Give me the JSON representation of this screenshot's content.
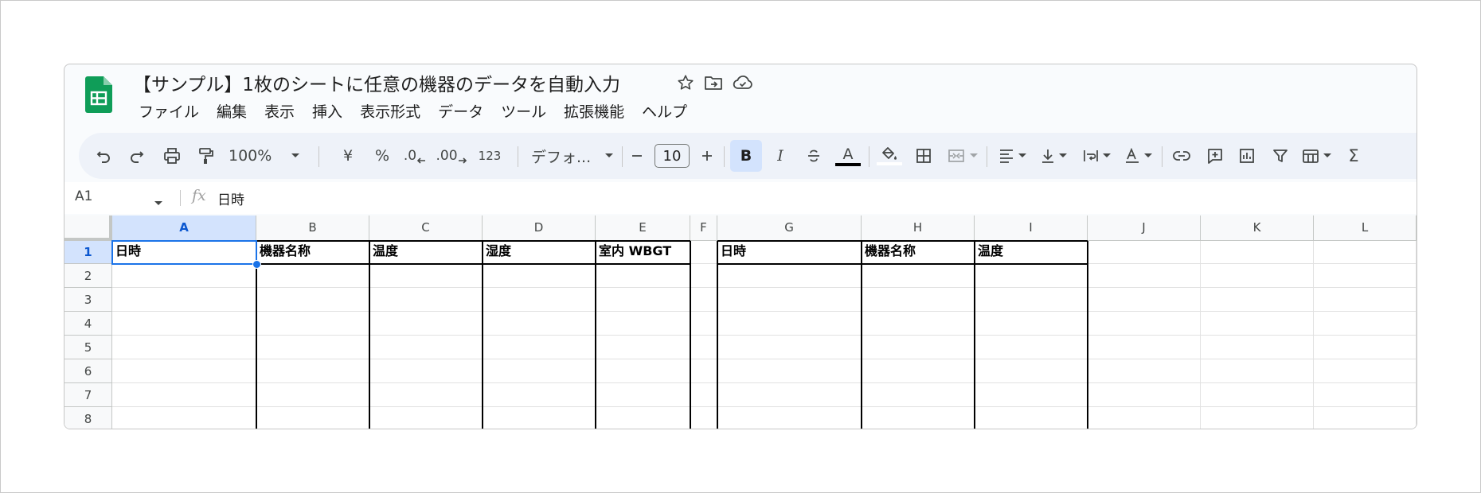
{
  "doc": {
    "title": "【サンプル】1枚のシートに任意の機器のデータを自動入力"
  },
  "title_icons": [
    "star-icon",
    "move-to-folder-icon",
    "cloud-status-icon"
  ],
  "menu": [
    "ファイル",
    "編集",
    "表示",
    "挿入",
    "表示形式",
    "データ",
    "ツール",
    "拡張機能",
    "ヘルプ"
  ],
  "toolbar": {
    "zoom": "100%",
    "currency": "¥",
    "percent": "%",
    "decimal_decrease": ".0",
    "decimal_increase": ".00",
    "number_format": "123",
    "font": "デフォ...",
    "font_size": "10",
    "bold": "B",
    "italic": "I",
    "text_color": "A",
    "sum": "Σ"
  },
  "formula_bar": {
    "cell_ref": "A1",
    "fx": "fx",
    "value": "日時"
  },
  "sheet": {
    "columns": [
      "A",
      "B",
      "C",
      "D",
      "E",
      "F",
      "G",
      "H",
      "I",
      "J",
      "K",
      "L"
    ],
    "rows": [
      "1",
      "2",
      "3",
      "4",
      "5",
      "6",
      "7",
      "8"
    ],
    "row1": [
      "日時",
      "機器名称",
      "温度",
      "湿度",
      "室内 WBGT",
      "",
      "日時",
      "機器名称",
      "温度",
      "",
      "",
      ""
    ],
    "selected_cell": "A1"
  },
  "colors": {
    "accent": "#1a73e8",
    "selection_fill": "#d3e3fd",
    "sheets_green": "#0f9d58"
  }
}
